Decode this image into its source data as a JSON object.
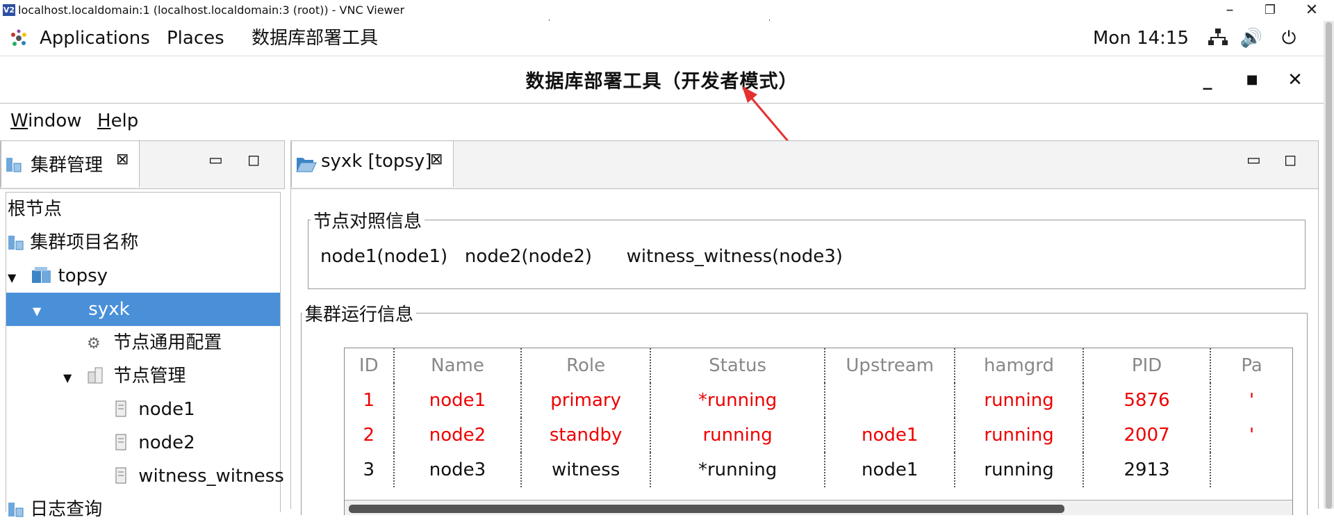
{
  "vnc": {
    "title": "localhost.localdomain:1 (localhost.localdomain:3 (root)) - VNC Viewer",
    "logo": "V2"
  },
  "topbar": {
    "applications": "Applications",
    "places": "Places",
    "app_menu": "数据库部署工具",
    "clock": "Mon 14:15"
  },
  "window": {
    "title": "数据库部署工具（开发者模式）"
  },
  "menubar": {
    "window_first": "W",
    "window_rest": "indow",
    "help_first": "H",
    "help_rest": "elp"
  },
  "left_tab": {
    "label": "集群管理"
  },
  "tree": {
    "items": [
      {
        "label": "根节点"
      },
      {
        "label": "集群项目名称"
      },
      {
        "label": "topsy"
      },
      {
        "label": "syxk"
      },
      {
        "label": "节点通用配置"
      },
      {
        "label": "节点管理"
      },
      {
        "label": "node1"
      },
      {
        "label": "node2"
      },
      {
        "label": "witness_witness"
      },
      {
        "label": "日志查询"
      }
    ]
  },
  "right_tab": {
    "label": "syxk [topsy]"
  },
  "node_info": {
    "legend": "节点对照信息",
    "text": "node1(node1)   node2(node2)      witness_witness(node3)"
  },
  "cluster_info": {
    "legend": "集群运行信息",
    "headers": [
      "ID",
      "Name",
      "Role",
      "Status",
      "Upstream",
      "hamgrd",
      "PID",
      "Pa"
    ],
    "rows": [
      [
        "1",
        "node1",
        "primary",
        "*running",
        "",
        "running",
        "5876",
        "'"
      ],
      [
        "2",
        "node2",
        "standby",
        "running",
        "node1",
        "running",
        "2007",
        "'"
      ],
      [
        "3",
        "node3",
        "witness",
        "*running",
        "node1",
        "running",
        "2913",
        ""
      ]
    ],
    "highlight_color": "#e00000"
  },
  "colors": {
    "selection": "#4a90d9",
    "annotation_arrow": "#e53030"
  }
}
